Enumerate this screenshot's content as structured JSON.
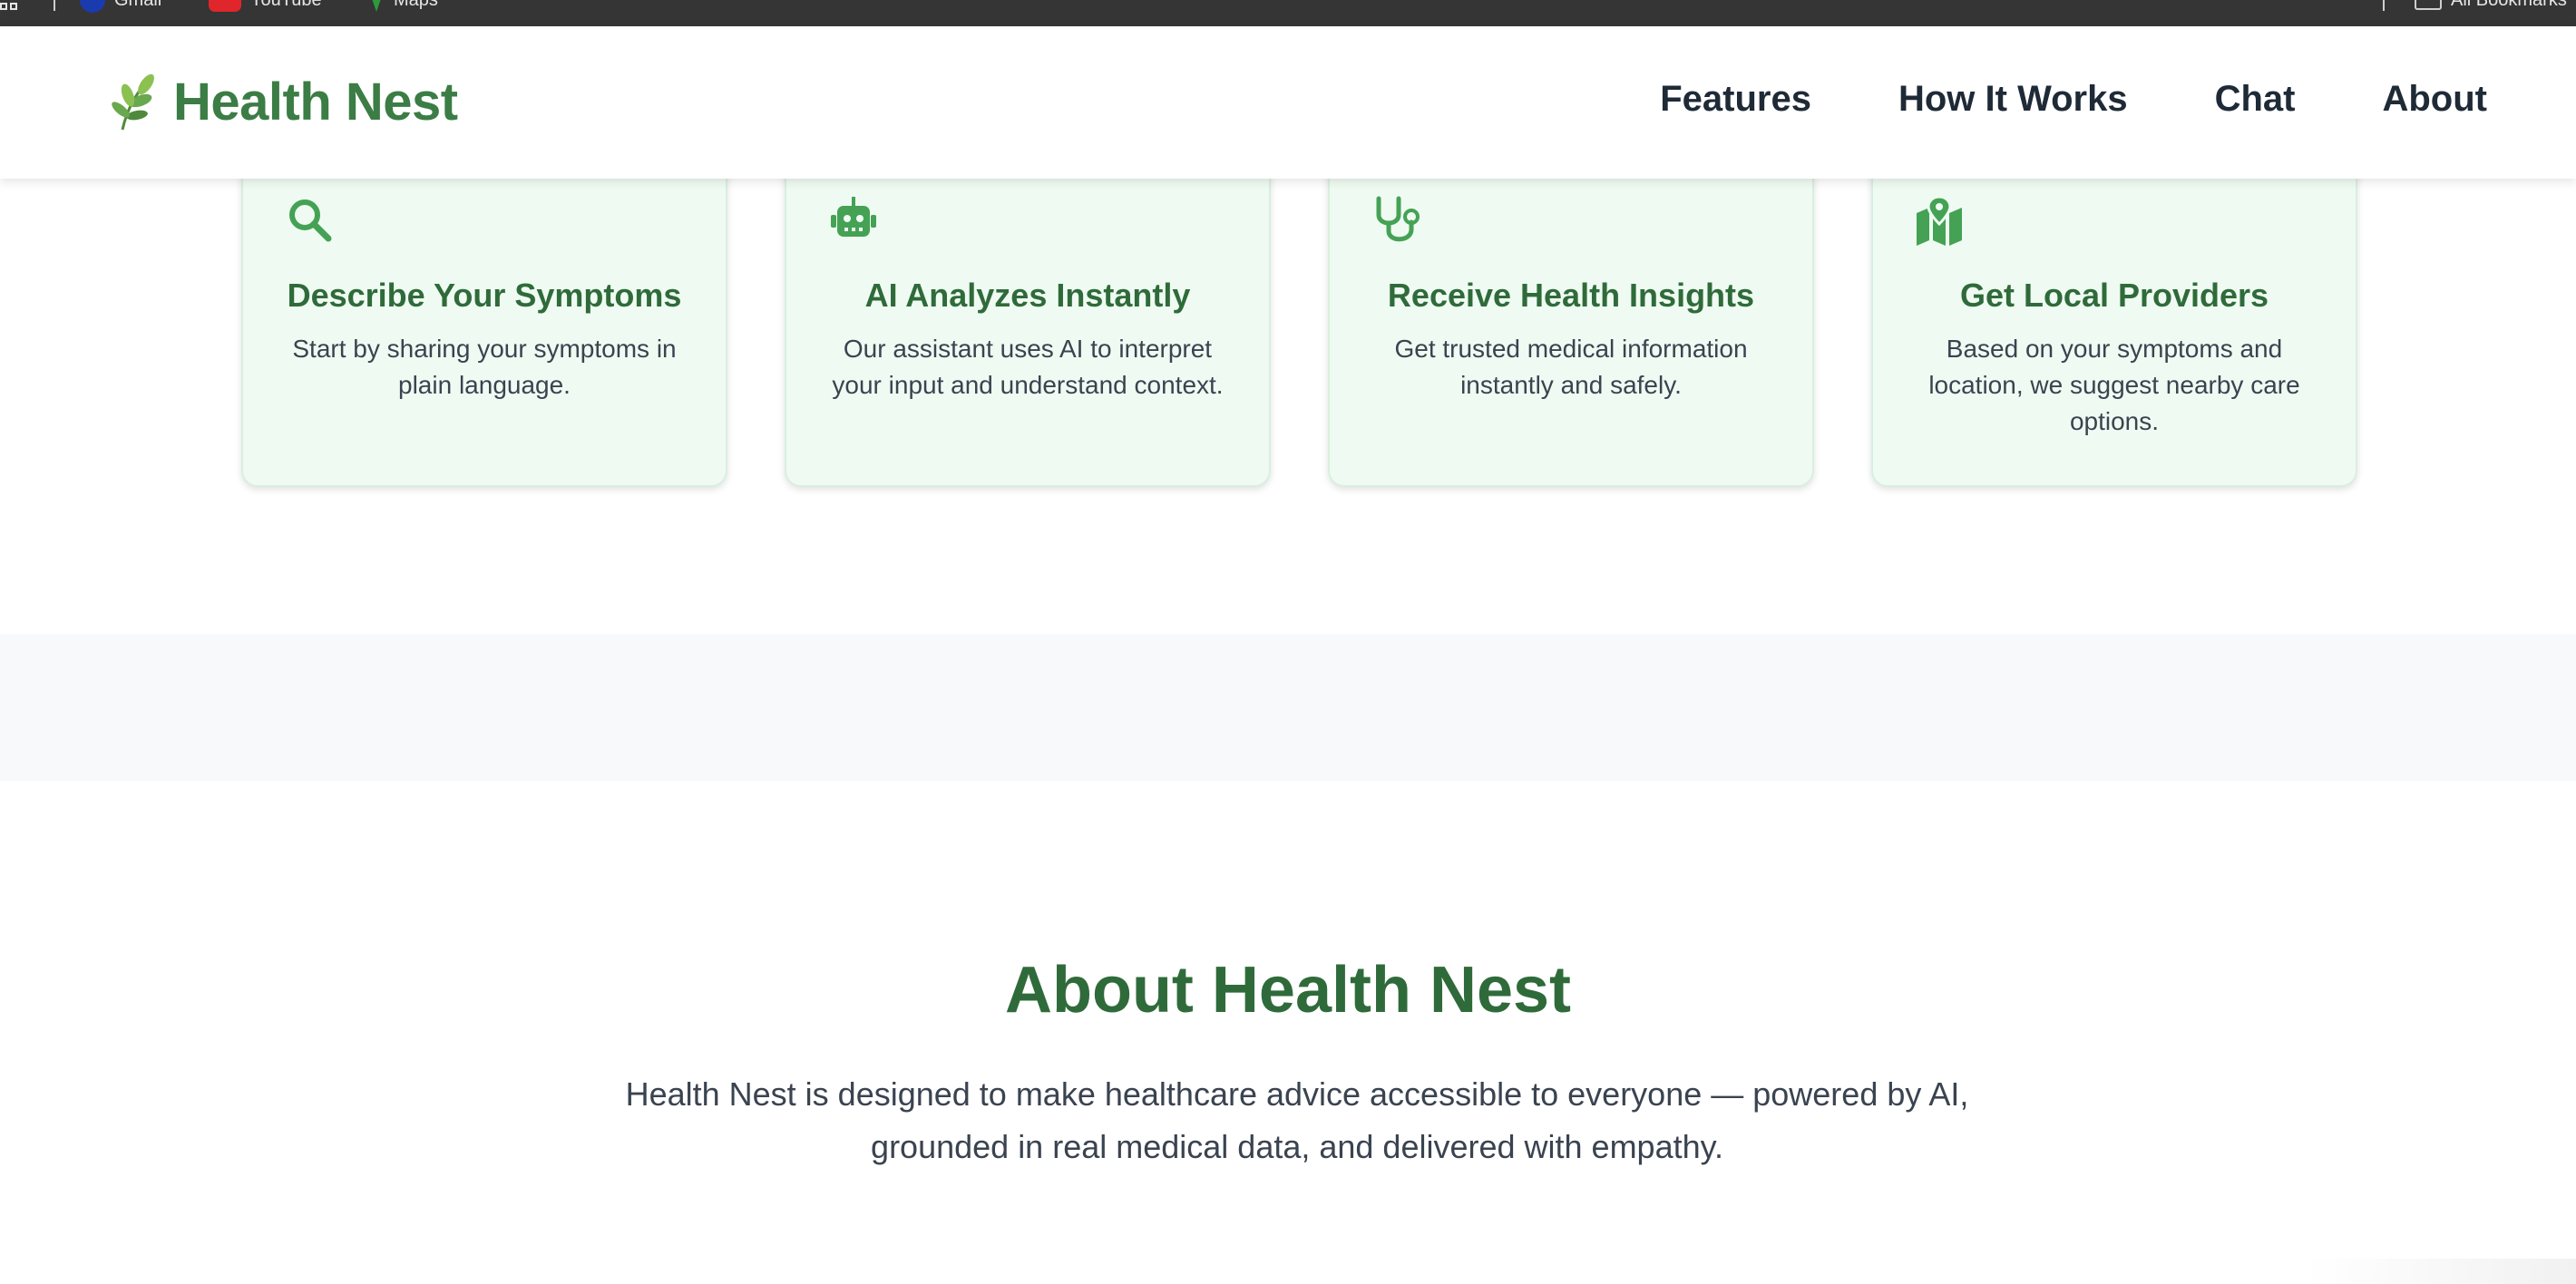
{
  "bookmarks": {
    "items": [
      {
        "label": "Gmail",
        "icon": "gmail-icon"
      },
      {
        "label": "YouTube",
        "icon": "youtube-icon"
      },
      {
        "label": "Maps",
        "icon": "maps-icon"
      }
    ],
    "all_bookmarks": "All Bookmarks"
  },
  "header": {
    "logo_text": "Health Nest",
    "logo_icon": "leaf-sprig-icon",
    "nav": [
      {
        "label": "Features"
      },
      {
        "label": "How It Works"
      },
      {
        "label": "Chat"
      },
      {
        "label": "About"
      }
    ]
  },
  "steps": [
    {
      "icon": "search-icon",
      "title": "Describe Your Symptoms",
      "desc": "Start by sharing your symptoms in plain language."
    },
    {
      "icon": "robot-icon",
      "title": "AI Analyzes Instantly",
      "desc": "Our assistant uses AI to interpret your input and understand context."
    },
    {
      "icon": "stethoscope-icon",
      "title": "Receive Health Insights",
      "desc": "Get trusted medical information instantly and safely."
    },
    {
      "icon": "map-location-icon",
      "title": "Get Local Providers",
      "desc": "Based on your symptoms and location, we suggest nearby care options."
    }
  ],
  "about": {
    "title": "About Health Nest",
    "text": "Health Nest is designed to make healthcare advice accessible to everyone — powered by AI, grounded in real medical data, and delivered with empathy."
  },
  "colors": {
    "brand_green": "#3b7d45",
    "heading_green": "#2f6b3a",
    "icon_green": "#45a255",
    "card_bg": "#effbf2",
    "nav_text": "#1f2a37",
    "body_text": "#3a4350",
    "band_gray": "#f8f9fb"
  }
}
